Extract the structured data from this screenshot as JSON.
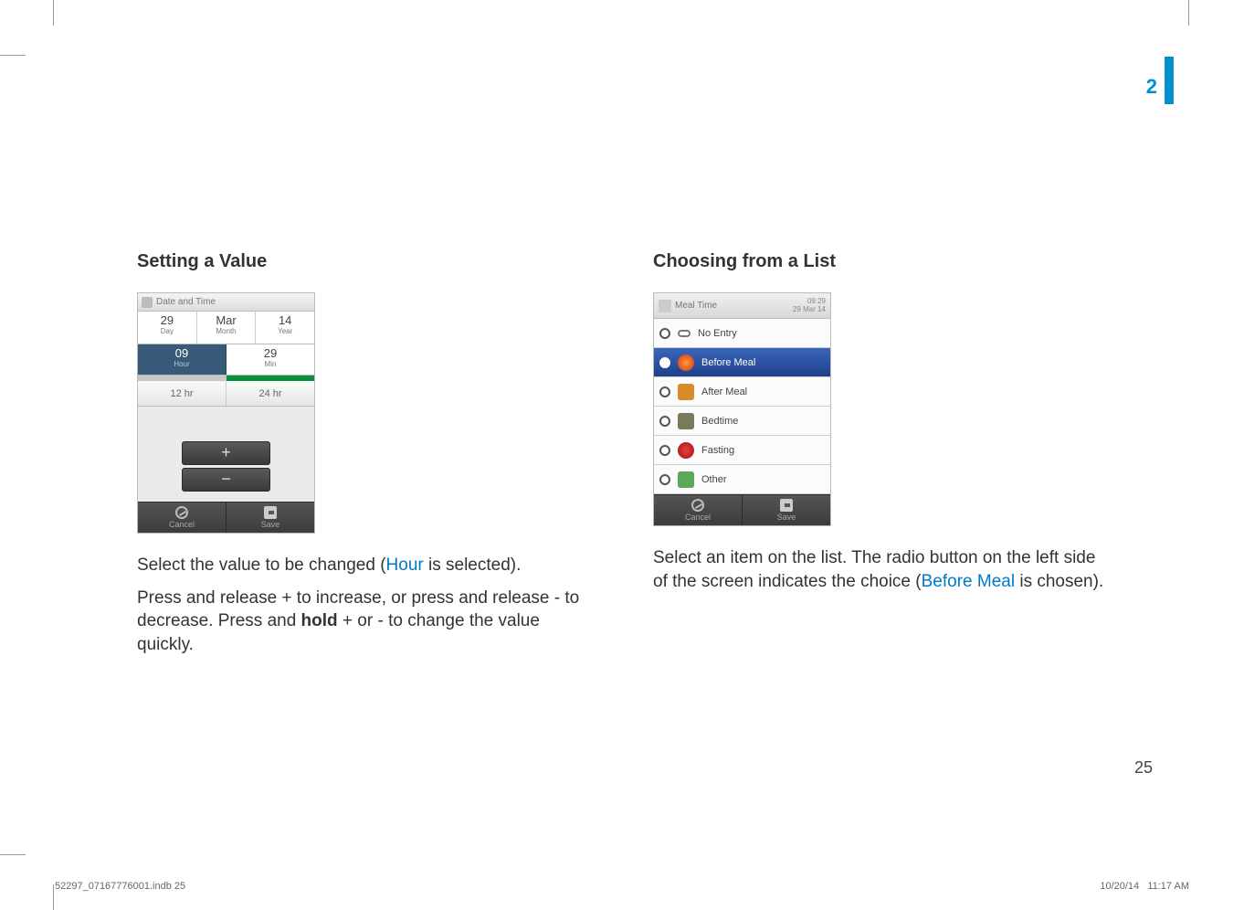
{
  "chapter": "2",
  "page_number": "25",
  "print_footer": {
    "filename": "52297_07167776001.indb   25",
    "date": "10/20/14",
    "time": "11:17 AM"
  },
  "left": {
    "heading": "Setting a Value",
    "para1_a": "Select the value to be changed (",
    "para1_highlight": "Hour",
    "para1_b": " is selected).",
    "para2_a": "Press and release + to increase, or press and release - to decrease. Press and ",
    "para2_bold": "hold",
    "para2_b": " + or - to change the value quickly."
  },
  "right": {
    "heading": "Choosing from a List",
    "para1_a": "Select an item on the list. The radio button on the left side of the screen indicates the choice (",
    "para1_highlight": "Before Meal",
    "para1_b": " is chosen)."
  },
  "screen1": {
    "title": "Date and Time",
    "day": {
      "value": "29",
      "label": "Day"
    },
    "month": {
      "value": "Mar",
      "label": "Month"
    },
    "year": {
      "value": "14",
      "label": "Year"
    },
    "hour": {
      "value": "09",
      "label": "Hour"
    },
    "min": {
      "value": "29",
      "label": "Min"
    },
    "fmt12": "12 hr",
    "fmt24": "24 hr",
    "plus": "+",
    "minus": "−",
    "cancel": "Cancel",
    "save": "Save"
  },
  "screen2": {
    "title": "Meal Time",
    "clock_time": "09:29",
    "clock_date": "29 Mar 14",
    "items": {
      "0": "No Entry",
      "1": "Before Meal",
      "2": "After Meal",
      "3": "Bedtime",
      "4": "Fasting",
      "5": "Other"
    },
    "cancel": "Cancel",
    "save": "Save"
  }
}
